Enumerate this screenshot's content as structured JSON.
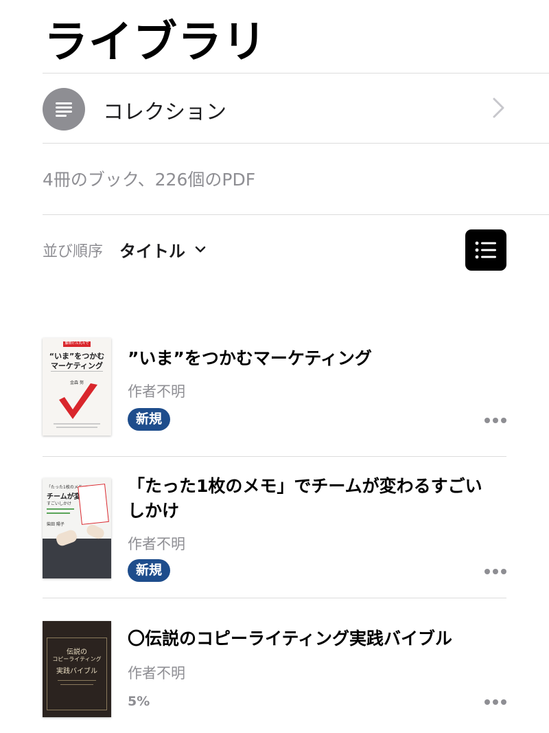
{
  "header": {
    "title": "ライブラリ"
  },
  "collections": {
    "label": "コレクション",
    "icon": "list-icon"
  },
  "summary": {
    "count_text": "4冊のブック、226個のPDF"
  },
  "sort": {
    "label": "並び順序",
    "value": "タイトル",
    "view_icon": "list-view-icon"
  },
  "colors": {
    "badge": "#1e4d8c",
    "secondary_text": "#8e8e93",
    "icon_gray": "#8e8e93"
  },
  "books": [
    {
      "title": "”いま”をつかむマーケティング",
      "author": "作者不明",
      "badge": "新規",
      "cover": {
        "band": "藤田ビル丸々で",
        "line1": "“いま”をつかむ",
        "line2": "マーケティング",
        "author": "金森 努"
      }
    },
    {
      "title": "「たった1枚のメモ」でチームが変わるすごいしかけ",
      "author": "作者不明",
      "badge": "新規",
      "cover": {
        "line1": "「たった1枚のメモ」で",
        "line2": "チームが変わる",
        "line3": "すごいしかけ",
        "author": "柴田 陽子"
      }
    },
    {
      "title": "〇伝説のコピーライティング実践バイブル",
      "author": "作者不明",
      "progress": "5%",
      "cover": {
        "line1": "伝説の",
        "line2": "コピーライティング",
        "line3": "実践バイブル"
      }
    }
  ]
}
